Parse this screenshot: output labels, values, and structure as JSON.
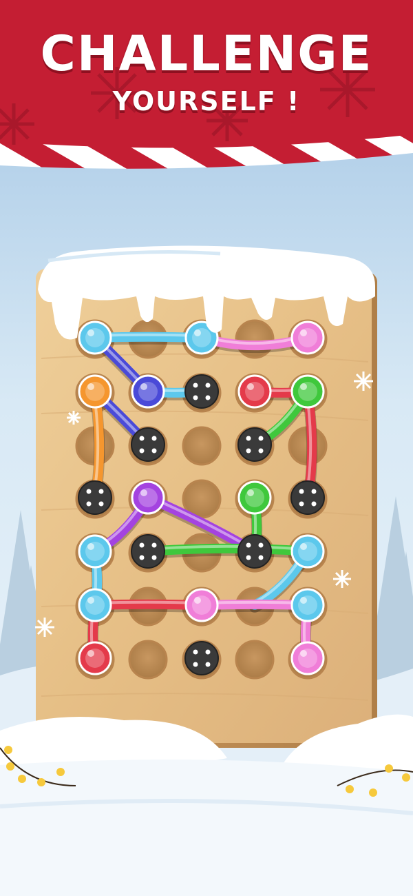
{
  "banner": {
    "title_line1": "CHALLENGE",
    "title_line2": "YOURSELF !"
  },
  "colors": {
    "banner_red": "#c41e33",
    "sky_top": "#a9c9e6",
    "board_wood": "#e8c48c",
    "rope_cyan": "#5cc8ec",
    "rope_blue": "#4a4ad8",
    "rope_orange": "#f5962e",
    "rope_red": "#e43a4a",
    "rope_green": "#3fc83c",
    "rope_purple": "#a443e0",
    "rope_pink": "#f07ed8",
    "screw_dark": "#3a3a3a"
  },
  "board": {
    "rows": 7,
    "cols": 5,
    "holes": [
      [
        "cyan-peg",
        "empty",
        "cyan-peg",
        "empty",
        "pink-peg"
      ],
      [
        "orange-peg",
        "blue-peg",
        "screw",
        "red-peg",
        "green-peg"
      ],
      [
        "empty",
        "screw",
        "empty",
        "screw",
        "empty"
      ],
      [
        "screw",
        "purple-peg",
        "empty",
        "green-peg",
        "screw"
      ],
      [
        "cyan-peg",
        "screw",
        "empty",
        "screw",
        "cyan-peg"
      ],
      [
        "cyan-peg",
        "empty",
        "pink-peg",
        "empty",
        "cyan-peg"
      ],
      [
        "red-peg",
        "empty",
        "screw",
        "empty",
        "pink-peg"
      ]
    ]
  },
  "ropes": [
    {
      "color": "cyan",
      "from": [
        0,
        0
      ],
      "to": [
        0,
        2
      ]
    },
    {
      "color": "pink",
      "from": [
        0,
        4
      ],
      "to": [
        0,
        2
      ]
    },
    {
      "color": "blue",
      "from": [
        0,
        0
      ],
      "to": [
        1,
        1
      ]
    },
    {
      "color": "orange",
      "from": [
        1,
        0
      ],
      "to": [
        3,
        0
      ]
    },
    {
      "color": "blue",
      "from": [
        1,
        0
      ],
      "to": [
        2,
        1
      ]
    },
    {
      "color": "cyan",
      "from": [
        1,
        1
      ],
      "to": [
        1,
        2
      ]
    },
    {
      "color": "red",
      "from": [
        1,
        3
      ],
      "to": [
        1,
        4
      ]
    },
    {
      "color": "green",
      "from": [
        1,
        4
      ],
      "to": [
        2,
        3
      ]
    },
    {
      "color": "red",
      "from": [
        1,
        4
      ],
      "to": [
        3,
        4
      ]
    },
    {
      "color": "purple",
      "from": [
        3,
        1
      ],
      "to": [
        4,
        0
      ]
    },
    {
      "color": "purple",
      "from": [
        3,
        1
      ],
      "to": [
        4,
        3
      ]
    },
    {
      "color": "green",
      "from": [
        4,
        1
      ],
      "to": [
        4,
        4
      ]
    },
    {
      "color": "green",
      "from": [
        3,
        3
      ],
      "to": [
        4,
        3
      ]
    },
    {
      "color": "cyan",
      "from": [
        4,
        0
      ],
      "to": [
        5,
        0
      ]
    },
    {
      "color": "cyan",
      "from": [
        4,
        4
      ],
      "to": [
        5,
        3
      ]
    },
    {
      "color": "red",
      "from": [
        5,
        0
      ],
      "to": [
        5,
        2
      ]
    },
    {
      "color": "red",
      "from": [
        6,
        0
      ],
      "to": [
        5,
        0
      ]
    },
    {
      "color": "pink",
      "from": [
        5,
        2
      ],
      "to": [
        5,
        4
      ]
    },
    {
      "color": "pink",
      "from": [
        6,
        4
      ],
      "to": [
        5,
        4
      ]
    }
  ]
}
